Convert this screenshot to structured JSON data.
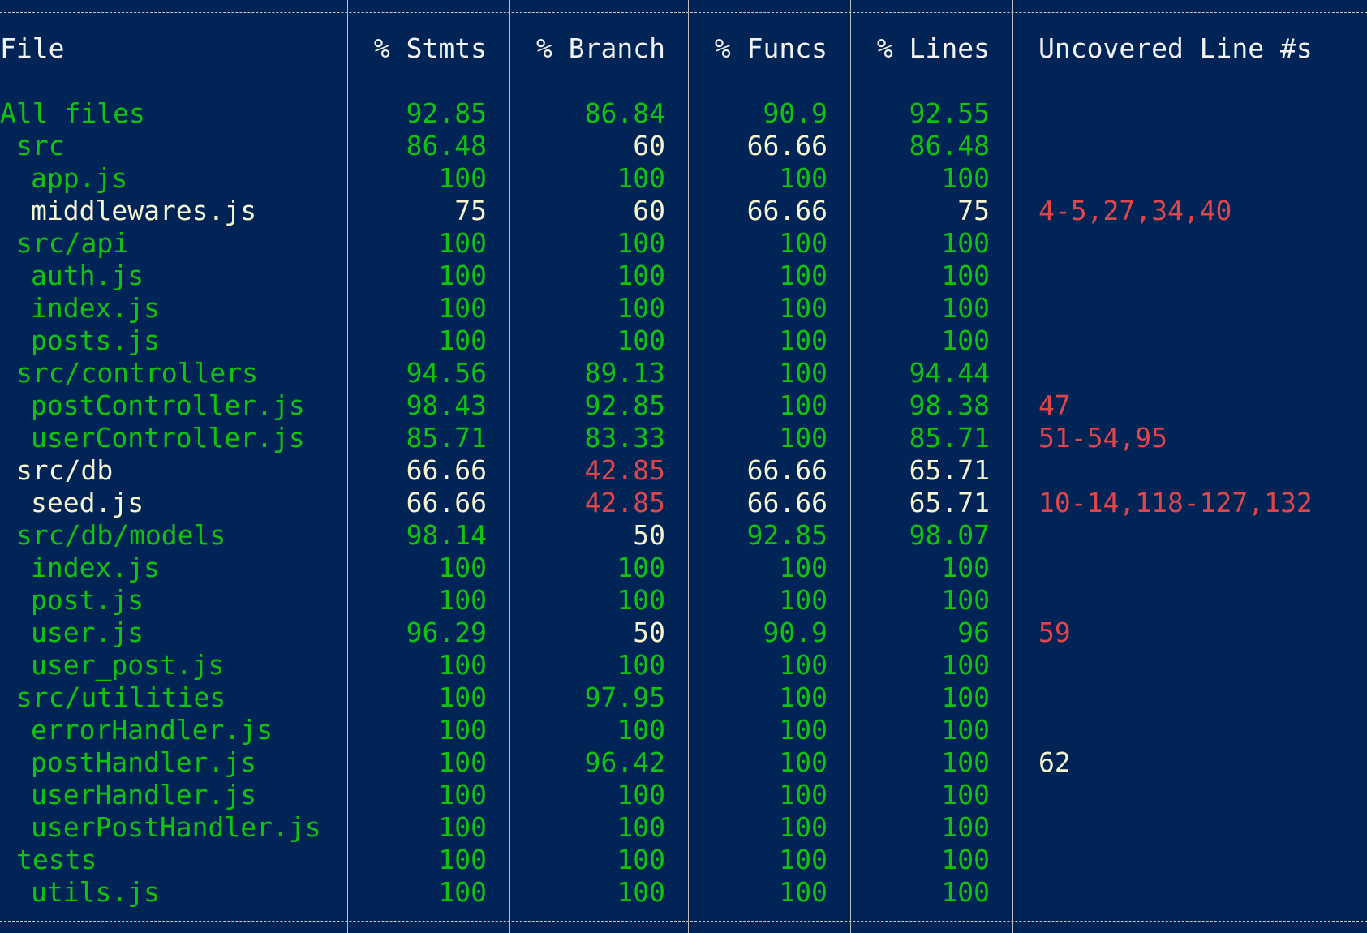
{
  "colors": {
    "background": "#012456",
    "high": "#13c20f",
    "medium": "#f5f5cf",
    "low": "#e0454a",
    "plain": "#f2f2f2"
  },
  "header": {
    "file": "File",
    "stmts": "% Stmts",
    "branch": "% Branch",
    "funcs": "% Funcs",
    "lines": "% Lines",
    "uncovered": "Uncovered Line #s"
  },
  "rows": [
    {
      "file": "All files",
      "level": 0,
      "c": "g",
      "stmts": "92.85",
      "s": "g",
      "branch": "86.84",
      "b": "g",
      "funcs": "90.9",
      "f": "g",
      "lines": "92.55",
      "l": "g",
      "uncovered": "",
      "u": "w"
    },
    {
      "file": "src",
      "level": 1,
      "c": "g",
      "stmts": "86.48",
      "s": "g",
      "branch": "60",
      "b": "y",
      "funcs": "66.66",
      "f": "y",
      "lines": "86.48",
      "l": "g",
      "uncovered": "",
      "u": "w"
    },
    {
      "file": "app.js",
      "level": 2,
      "c": "g",
      "stmts": "100",
      "s": "g",
      "branch": "100",
      "b": "g",
      "funcs": "100",
      "f": "g",
      "lines": "100",
      "l": "g",
      "uncovered": "",
      "u": "w"
    },
    {
      "file": "middlewares.js",
      "level": 2,
      "c": "y",
      "stmts": "75",
      "s": "y",
      "branch": "60",
      "b": "y",
      "funcs": "66.66",
      "f": "y",
      "lines": "75",
      "l": "y",
      "uncovered": "4-5,27,34,40",
      "u": "r"
    },
    {
      "file": "src/api",
      "level": 1,
      "c": "g",
      "stmts": "100",
      "s": "g",
      "branch": "100",
      "b": "g",
      "funcs": "100",
      "f": "g",
      "lines": "100",
      "l": "g",
      "uncovered": "",
      "u": "w"
    },
    {
      "file": "auth.js",
      "level": 2,
      "c": "g",
      "stmts": "100",
      "s": "g",
      "branch": "100",
      "b": "g",
      "funcs": "100",
      "f": "g",
      "lines": "100",
      "l": "g",
      "uncovered": "",
      "u": "w"
    },
    {
      "file": "index.js",
      "level": 2,
      "c": "g",
      "stmts": "100",
      "s": "g",
      "branch": "100",
      "b": "g",
      "funcs": "100",
      "f": "g",
      "lines": "100",
      "l": "g",
      "uncovered": "",
      "u": "w"
    },
    {
      "file": "posts.js",
      "level": 2,
      "c": "g",
      "stmts": "100",
      "s": "g",
      "branch": "100",
      "b": "g",
      "funcs": "100",
      "f": "g",
      "lines": "100",
      "l": "g",
      "uncovered": "",
      "u": "w"
    },
    {
      "file": "src/controllers",
      "level": 1,
      "c": "g",
      "stmts": "94.56",
      "s": "g",
      "branch": "89.13",
      "b": "g",
      "funcs": "100",
      "f": "g",
      "lines": "94.44",
      "l": "g",
      "uncovered": "",
      "u": "w"
    },
    {
      "file": "postController.js",
      "level": 2,
      "c": "g",
      "stmts": "98.43",
      "s": "g",
      "branch": "92.85",
      "b": "g",
      "funcs": "100",
      "f": "g",
      "lines": "98.38",
      "l": "g",
      "uncovered": "47",
      "u": "r"
    },
    {
      "file": "userController.js",
      "level": 2,
      "c": "g",
      "stmts": "85.71",
      "s": "g",
      "branch": "83.33",
      "b": "g",
      "funcs": "100",
      "f": "g",
      "lines": "85.71",
      "l": "g",
      "uncovered": "51-54,95",
      "u": "r"
    },
    {
      "file": "src/db",
      "level": 1,
      "c": "y",
      "stmts": "66.66",
      "s": "y",
      "branch": "42.85",
      "b": "r",
      "funcs": "66.66",
      "f": "y",
      "lines": "65.71",
      "l": "y",
      "uncovered": "",
      "u": "w"
    },
    {
      "file": "seed.js",
      "level": 2,
      "c": "y",
      "stmts": "66.66",
      "s": "y",
      "branch": "42.85",
      "b": "r",
      "funcs": "66.66",
      "f": "y",
      "lines": "65.71",
      "l": "y",
      "uncovered": "10-14,118-127,132",
      "u": "r"
    },
    {
      "file": "src/db/models",
      "level": 1,
      "c": "g",
      "stmts": "98.14",
      "s": "g",
      "branch": "50",
      "b": "y",
      "funcs": "92.85",
      "f": "g",
      "lines": "98.07",
      "l": "g",
      "uncovered": "",
      "u": "w"
    },
    {
      "file": "index.js",
      "level": 2,
      "c": "g",
      "stmts": "100",
      "s": "g",
      "branch": "100",
      "b": "g",
      "funcs": "100",
      "f": "g",
      "lines": "100",
      "l": "g",
      "uncovered": "",
      "u": "w"
    },
    {
      "file": "post.js",
      "level": 2,
      "c": "g",
      "stmts": "100",
      "s": "g",
      "branch": "100",
      "b": "g",
      "funcs": "100",
      "f": "g",
      "lines": "100",
      "l": "g",
      "uncovered": "",
      "u": "w"
    },
    {
      "file": "user.js",
      "level": 2,
      "c": "g",
      "stmts": "96.29",
      "s": "g",
      "branch": "50",
      "b": "y",
      "funcs": "90.9",
      "f": "g",
      "lines": "96",
      "l": "g",
      "uncovered": "59",
      "u": "r"
    },
    {
      "file": "user_post.js",
      "level": 2,
      "c": "g",
      "stmts": "100",
      "s": "g",
      "branch": "100",
      "b": "g",
      "funcs": "100",
      "f": "g",
      "lines": "100",
      "l": "g",
      "uncovered": "",
      "u": "w"
    },
    {
      "file": "src/utilities",
      "level": 1,
      "c": "g",
      "stmts": "100",
      "s": "g",
      "branch": "97.95",
      "b": "g",
      "funcs": "100",
      "f": "g",
      "lines": "100",
      "l": "g",
      "uncovered": "",
      "u": "w"
    },
    {
      "file": "errorHandler.js",
      "level": 2,
      "c": "g",
      "stmts": "100",
      "s": "g",
      "branch": "100",
      "b": "g",
      "funcs": "100",
      "f": "g",
      "lines": "100",
      "l": "g",
      "uncovered": "",
      "u": "w"
    },
    {
      "file": "postHandler.js",
      "level": 2,
      "c": "g",
      "stmts": "100",
      "s": "g",
      "branch": "96.42",
      "b": "g",
      "funcs": "100",
      "f": "g",
      "lines": "100",
      "l": "g",
      "uncovered": "62",
      "u": "y"
    },
    {
      "file": "userHandler.js",
      "level": 2,
      "c": "g",
      "stmts": "100",
      "s": "g",
      "branch": "100",
      "b": "g",
      "funcs": "100",
      "f": "g",
      "lines": "100",
      "l": "g",
      "uncovered": "",
      "u": "w"
    },
    {
      "file": "userPostHandler.js",
      "level": 2,
      "c": "g",
      "stmts": "100",
      "s": "g",
      "branch": "100",
      "b": "g",
      "funcs": "100",
      "f": "g",
      "lines": "100",
      "l": "g",
      "uncovered": "",
      "u": "w"
    },
    {
      "file": "tests",
      "level": 1,
      "c": "g",
      "stmts": "100",
      "s": "g",
      "branch": "100",
      "b": "g",
      "funcs": "100",
      "f": "g",
      "lines": "100",
      "l": "g",
      "uncovered": "",
      "u": "w"
    },
    {
      "file": "utils.js",
      "level": 2,
      "c": "g",
      "stmts": "100",
      "s": "g",
      "branch": "100",
      "b": "g",
      "funcs": "100",
      "f": "g",
      "lines": "100",
      "l": "g",
      "uncovered": "",
      "u": "w"
    }
  ]
}
